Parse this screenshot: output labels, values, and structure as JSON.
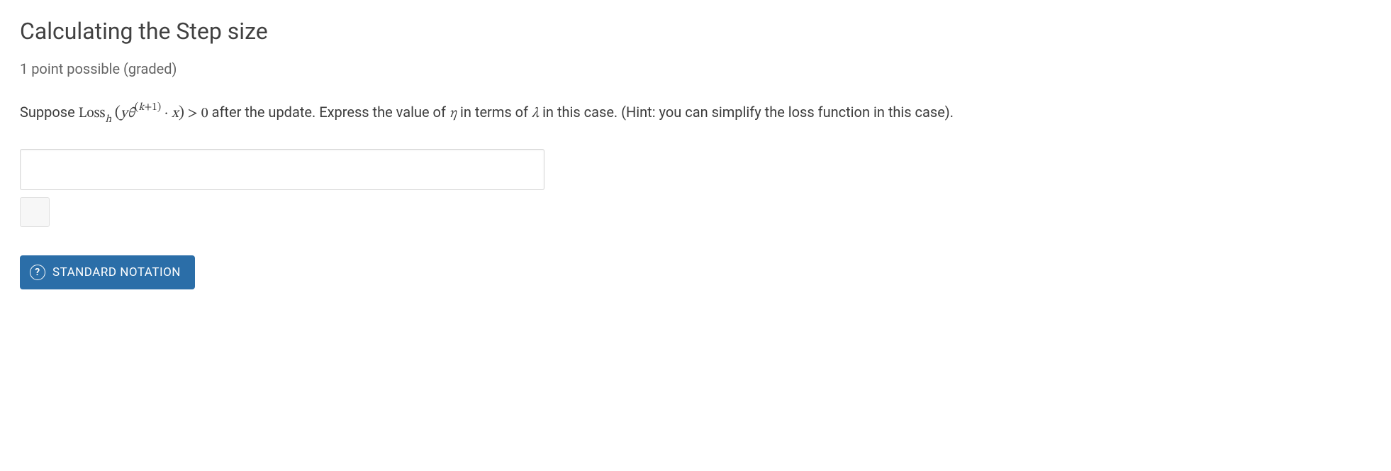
{
  "title": "Calculating the Step size",
  "points": "1 point possible (graded)",
  "question": {
    "prefix": "Suppose ",
    "loss_word": "Loss",
    "loss_sub": "h",
    "inner_y": "y",
    "inner_theta": "θ",
    "inner_sup_open": "(",
    "inner_sup_k": "k",
    "inner_sup_plus": "+1)",
    "dot": " · ",
    "inner_x": "x",
    "gt": " > 0",
    "mid1": " after the update. Express the value of ",
    "eta": "η",
    "mid2": " in terms of ",
    "lambda": "λ",
    "suffix": " in this case. (Hint: you can simplify the loss function in this case)."
  },
  "input": {
    "value": "",
    "placeholder": ""
  },
  "button": {
    "help_icon": "?",
    "label": "STANDARD NOTATION"
  }
}
